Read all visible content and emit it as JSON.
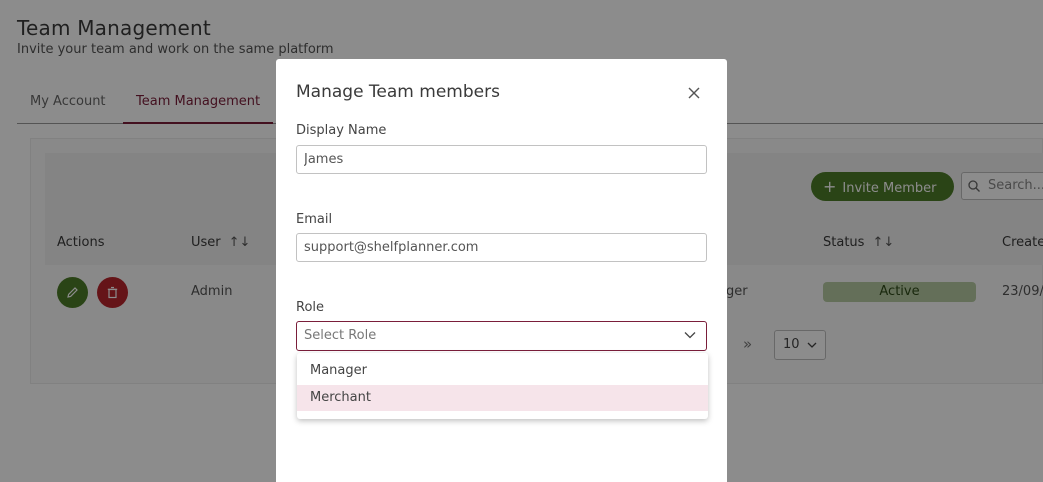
{
  "page": {
    "title": "Team Management",
    "subtitle": "Invite your team and work on the same platform"
  },
  "tabs": [
    {
      "label": "My Account",
      "active": false
    },
    {
      "label": "Team Management",
      "active": true
    }
  ],
  "toolbar": {
    "invite_label": "Invite Member",
    "search_placeholder": "Search..."
  },
  "table": {
    "headers": {
      "actions": "Actions",
      "user": "User",
      "status": "Status",
      "created": "Create"
    },
    "rows": [
      {
        "user": "Admin",
        "role_fragment": "ger",
        "status": "Active",
        "created_fragment": "23/09/"
      }
    ]
  },
  "pagination": {
    "next_label": "»",
    "page_size": "10"
  },
  "modal": {
    "title": "Manage Team members",
    "display_name_label": "Display Name",
    "display_name_value": "James",
    "email_label": "Email",
    "email_value": "support@shelfplanner.com",
    "role_label": "Role",
    "role_placeholder": "Select Role",
    "role_options": [
      "Manager",
      "Merchant"
    ],
    "highlighted_option": "Merchant"
  },
  "colors": {
    "brand_accent": "#7a1e3a",
    "primary_green": "#4d7d28",
    "danger_red": "#b9262c",
    "status_active_bg": "#b7cba3",
    "option_highlight": "#f6e4ea"
  },
  "icons": {
    "close": "close-icon",
    "chevron": "chevron-down-icon",
    "search": "search-icon",
    "edit": "pencil-icon",
    "delete": "trash-icon",
    "sort": "sort-icon",
    "plus": "plus-icon"
  }
}
